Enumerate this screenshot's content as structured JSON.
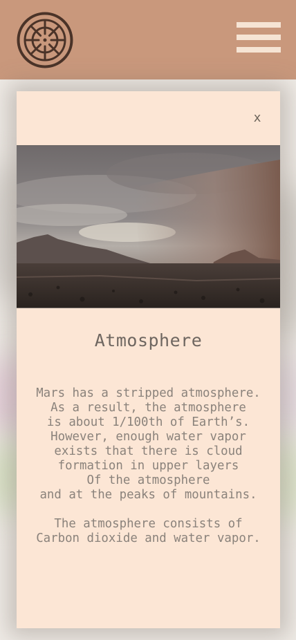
{
  "header": {
    "logo_icon": "ship-wheel-icon",
    "menu_icon": "hamburger-menu-icon"
  },
  "modal": {
    "close_label": "x",
    "image_alt": "Dust storm rolling over desert mountains",
    "title": "Atmosphere",
    "paragraphs": [
      "Mars has a stripped atmosphere.\nAs a result, the atmosphere\nis about 1/100th of Earth’s.\nHowever, enough water vapor\nexists that there is cloud\nformation in upper layers\nOf the atmosphere\nand at the peaks of mountains.",
      "The atmosphere consists of\nCarbon dioxide and water vapor."
    ]
  },
  "colors": {
    "header_bg": "#c9987c",
    "modal_bg": "#fce6d5",
    "menu_bars": "#f6e4d4",
    "logo_stroke": "#4a3328"
  }
}
